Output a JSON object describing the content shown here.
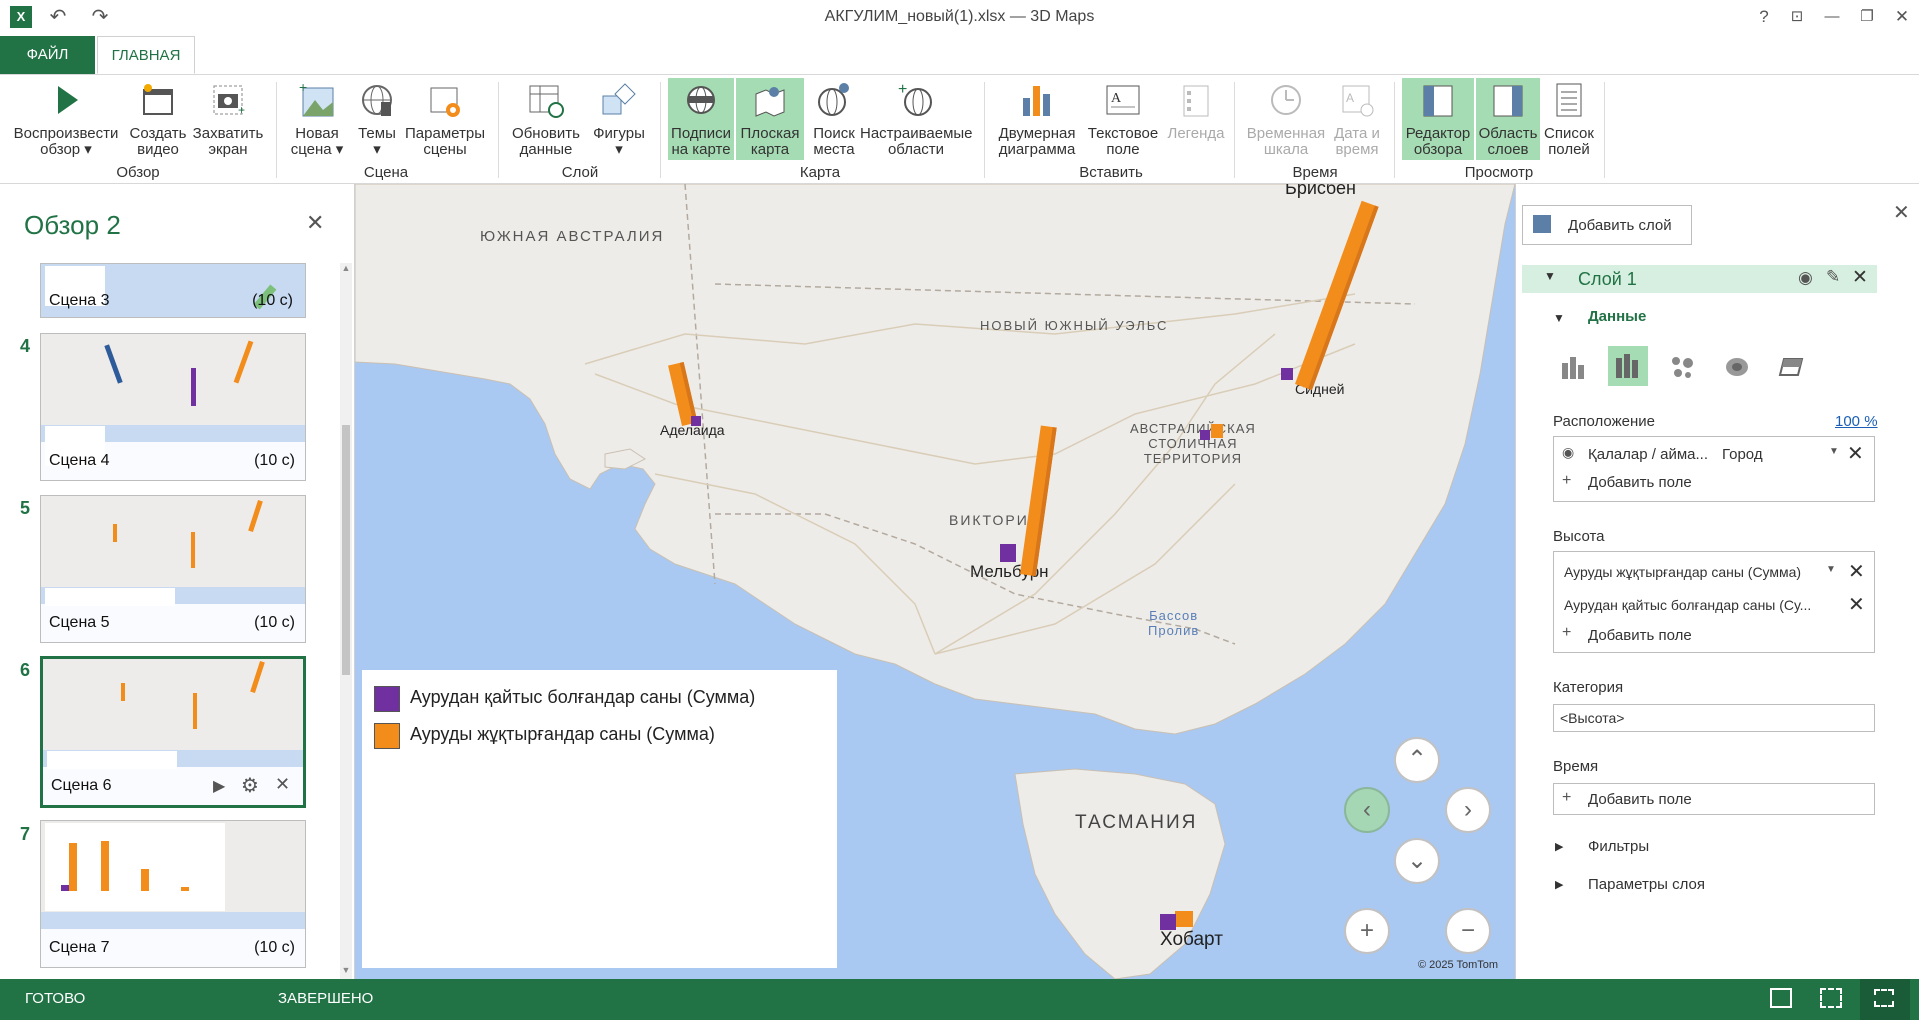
{
  "window": {
    "title": "АКГУЛИМ_новый(1).xlsx — 3D Maps",
    "controls": [
      "?",
      "⊡",
      "—",
      "❐",
      "✕"
    ]
  },
  "tabs": {
    "file": "ФАЙЛ",
    "home": "ГЛАВНАЯ"
  },
  "ribbon": {
    "play_tour": "Воспроизвести\nобзор ▾",
    "create_video": "Создать\nвидео",
    "capture_screen": "Захватить\nэкран",
    "new_scene": "Новая\nсцена ▾",
    "themes": "Темы\n▾",
    "scene_options": "Параметры\nсцены",
    "refresh_data": "Обновить\nданные",
    "shapes": "Фигуры\n▾",
    "map_labels": "Подписи\nна карте",
    "flat_map": "Плоская\nкарта",
    "find_location": "Поиск\nместа",
    "custom_regions": "Настраиваемые\nобласти",
    "chart_2d": "Двумерная\nдиаграмма",
    "text_box": "Текстовое\nполе",
    "legend": "Легенда",
    "timeline": "Временная\nшкала",
    "date_time": "Дата и\nвремя",
    "tour_editor": "Редактор\nобзора",
    "layer_pane": "Область\nслоев",
    "field_list": "Список\nполей",
    "groups": {
      "tour": "Обзор",
      "scene": "Сцена",
      "layer": "Слой",
      "map": "Карта",
      "insert": "Вставить",
      "time": "Время",
      "view": "Просмотр"
    }
  },
  "tour_panel": {
    "title": "Обзор 2",
    "scenes": [
      {
        "num": "",
        "name": "Сцена 3",
        "duration": "(10 с)"
      },
      {
        "num": "4",
        "name": "Сцена 4",
        "duration": "(10 с)"
      },
      {
        "num": "5",
        "name": "Сцена 5",
        "duration": "(10 с)"
      },
      {
        "num": "6",
        "name": "Сцена 6",
        "duration": ""
      },
      {
        "num": "7",
        "name": "Сцена 7",
        "duration": "(10 с)"
      }
    ]
  },
  "map": {
    "labels": {
      "south_australia": "ЮЖНАЯ АВСТРАЛИЯ",
      "nsw": "НОВЫЙ ЮЖНЫЙ УЭЛЬС",
      "act": "АВСТРАЛИЙСКАЯ\nСТОЛИЧНАЯ\nТЕРРИТОРИЯ",
      "victoria": "ВИКТОРИЯ",
      "bass": "Бассов\nПролив",
      "tasmania": "ТАСМАНИЯ",
      "brisbane": "Брисбен",
      "adelaide": "Аделаида",
      "sydney": "Сидней",
      "melbourne": "Мельбурн",
      "hobart": "Хобарт"
    },
    "copyright": "© 2025 TomTom",
    "legend": [
      {
        "label": "Аурудан қайтыс болғандар саны (Сумма)",
        "color": "#7030a0"
      },
      {
        "label": "Ауруды жұқтырғандар саны (Сумма)",
        "color": "#f28c1b"
      }
    ]
  },
  "layer_pane": {
    "add_layer": "Добавить слой",
    "layer_name": "Слой 1",
    "data_section": "Данные",
    "location_label": "Расположение",
    "location_pct": "100 %",
    "location_field": "Қалалар / айма...",
    "location_type": "Город",
    "add_field": "Добавить поле",
    "height_label": "Высота",
    "height_fields": [
      "Ауруды жұқтырғандар саны (Сумма)",
      "Аурудан қайтыс болғандар саны (Су..."
    ],
    "category_label": "Категория",
    "category_value": "<Высота>",
    "time_label": "Время",
    "filters": "Фильтры",
    "layer_options": "Параметры слоя"
  },
  "status": {
    "ready": "ГОТОВО",
    "done": "ЗАВЕРШЕНО"
  },
  "colors": {
    "accent": "#217346",
    "active": "#a6dcb4",
    "purple": "#7030a0",
    "orange": "#f28c1b",
    "water": "#a9c8f2"
  }
}
